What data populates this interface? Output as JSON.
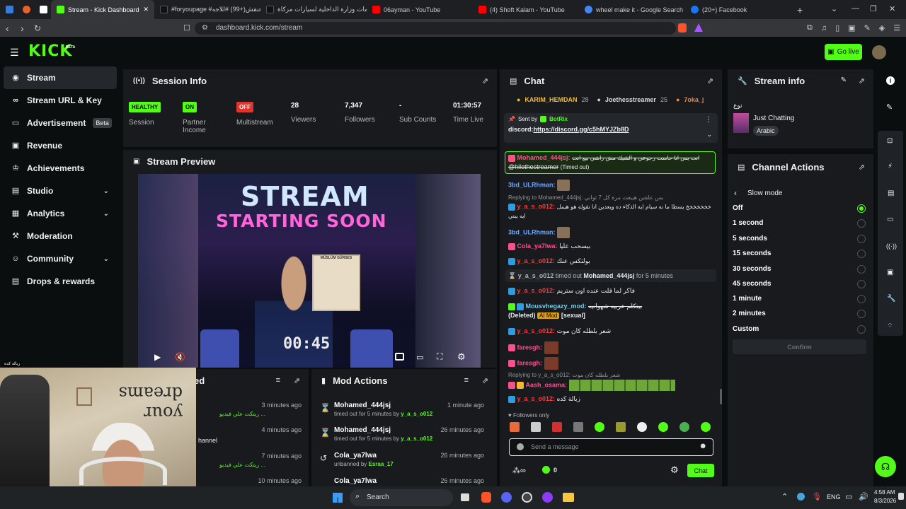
{
  "browser": {
    "tabs": [
      {
        "label": "",
        "color": "#3a7bd5"
      },
      {
        "label": "",
        "color": "#e8612c"
      },
      {
        "label": "",
        "color": "#ffffff"
      },
      {
        "label": "Stream - Kick Dashboard",
        "color": "#53fc18"
      },
      {
        "label": "#foryoupage #عنقش(+99) #للاجه",
        "color": "#111111"
      },
      {
        "label": "استعلامات وزارة الداخلية لسيارات مزكاة",
        "color": "#111111"
      },
      {
        "label": "06ayman - YouTube",
        "color": "#ff0000"
      },
      {
        "label": "(4) Shoft Kalam - YouTube",
        "color": "#ff0000"
      },
      {
        "label": "wheel make it - Google Search",
        "color": "#4285f4"
      },
      {
        "label": "(20+) Facebook",
        "color": "#1877f2"
      }
    ],
    "url": "dashboard.kick.com/stream"
  },
  "header": {
    "logo": "KICK",
    "beta": "BETA",
    "go_live": "Go live"
  },
  "sidebar": [
    {
      "label": "Stream",
      "icon": "broadcast-icon"
    },
    {
      "label": "Stream URL & Key",
      "icon": "link-icon"
    },
    {
      "label": "Advertisement",
      "icon": "ad-icon",
      "badge": "Beta"
    },
    {
      "label": "Revenue",
      "icon": "dollar-icon"
    },
    {
      "label": "Achievements",
      "icon": "trophy-icon"
    },
    {
      "label": "Studio",
      "icon": "studio-icon",
      "chevron": true
    },
    {
      "label": "Analytics",
      "icon": "chart-icon",
      "chevron": true
    },
    {
      "label": "Moderation",
      "icon": "hammer-icon"
    },
    {
      "label": "Community",
      "icon": "people-icon",
      "chevron": true
    },
    {
      "label": "Drops & rewards",
      "icon": "gift-icon"
    }
  ],
  "session": {
    "title": "Session Info",
    "health_badge": "HEALTHY",
    "health_label": "Session",
    "partner_badge": "ON",
    "partner_label": "Partner Income",
    "multistream_badge": "OFF",
    "multistream_label": "Multistream",
    "viewers_value": "28",
    "viewers_label": "Viewers",
    "followers_value": "7,347",
    "followers_label": "Followers",
    "subs_value": "-",
    "subs_label": "Sub Counts",
    "time_value": "01:30:57",
    "time_label": "Time Live"
  },
  "preview": {
    "title": "Stream Preview",
    "overlay_line1": "STREAM",
    "overlay_line2": "STARTING SOON",
    "timer": "00:45",
    "poster": "MÜSLÜM GÜRSES"
  },
  "recent": {
    "title_suffix": "ed",
    "rows": [
      {
        "text": "ريتكت علي فيديو ...",
        "time": "3 minutes ago"
      },
      {
        "text": "hannel",
        "time": "4 minutes ago"
      },
      {
        "text": "ريتكت علي فيديو ...",
        "time": "7 minutes ago"
      },
      {
        "text": "",
        "time": "10 minutes ago"
      }
    ]
  },
  "mod_actions": {
    "title": "Mod Actions",
    "rows": [
      {
        "name": "Mohamed_444jsj",
        "sub": "timed out for 5 minutes by",
        "by": "y_a_s_o012",
        "time": "1 minute ago",
        "icon": "hourglass-icon"
      },
      {
        "name": "Mohamed_444jsj",
        "sub": "timed out for 5 minutes by",
        "by": "y_a_s_o012",
        "time": "26 minutes ago",
        "icon": "hourglass-icon"
      },
      {
        "name": "Cola_ya7lwa",
        "sub": "unbanned by",
        "by": "Esraa_17",
        "time": "26 minutes ago",
        "icon": "undo-icon"
      },
      {
        "name": "Cola_ya7lwa",
        "sub": "",
        "by": "",
        "time": "26 minutes ago",
        "icon": "hourglass-icon"
      }
    ]
  },
  "chat": {
    "title": "Chat",
    "top_users": [
      {
        "name": "KARIM_HEMDAN",
        "count": "28"
      },
      {
        "name": "Joethesstreamer",
        "count": "25"
      },
      {
        "name": "7oka_j",
        "count": ""
      }
    ],
    "pinned_by_label": "Sent by",
    "pinned_by": "BotRix",
    "pinned_text": "discord:",
    "pinned_link": "https://discord.gg/c5hMYJZb8D",
    "messages": [
      {
        "user": "Mohamed_444jsj:",
        "text": "انت يس انا حاست رجوعي و الشيك مش راشي بيع انت",
        "extra": "@hilothestreamer",
        "note": "(Timed out)",
        "style": "highlight"
      },
      {
        "user": "3bd_ULRhman:",
        "text": "",
        "style": "normal"
      },
      {
        "reply": "Replying to Mohamed_444jsj: بس علشن هيبعت مرة كل 7 ثواني",
        "user": "y_a_s_o012:",
        "text": "خخخخخخخ يسطا ما نه سيام ايه الذكاء ده ويعدين انا نقوله هو هيمل ايه يبني",
        "style": "normal"
      },
      {
        "user": "3bd_ULRhman:",
        "text": "",
        "style": "normal"
      },
      {
        "user": "Cola_ya7lwa:",
        "text": "بيسحب عليا",
        "style": "normal"
      },
      {
        "user": "y_a_s_o012:",
        "text": "بولتكس عنك",
        "style": "normal"
      },
      {
        "system_user": "y_a_s_o012",
        "system_action": "timed out",
        "system_target": "Mohamed_444jsj",
        "system_suffix": "for 5 minutes",
        "style": "system"
      },
      {
        "user": "y_a_s_o012:",
        "text": "فاكر لما قلت عنده اون ستريم",
        "style": "normal"
      },
      {
        "user": "Mousvhegazy_mod:",
        "text": "بيتكلم عربيه شهوانيه",
        "extra": "(Deleted)",
        "tag": "AI Mod",
        "note": "[sexual]",
        "style": "normal"
      },
      {
        "user": "y_a_s_o012:",
        "text": "شعر بلطله كان موت",
        "style": "normal"
      },
      {
        "user": "faresgh:",
        "text": "",
        "style": "normal"
      },
      {
        "user": "faresgh:",
        "text": "",
        "style": "normal"
      },
      {
        "reply": "Replying to y_a_s_o012: شعر بلطله كان موت",
        "user": "Aash_osama:",
        "text": "",
        "style": "normal"
      },
      {
        "user": "y_a_s_o012:",
        "text": "زبالة كده",
        "style": "normal"
      }
    ],
    "followers_only": "Followers only",
    "input_placeholder": "Send a message",
    "counter": "0",
    "send_label": "Chat"
  },
  "stream_info": {
    "title": "Stream info",
    "category": "Just Chatting",
    "language": "Arabic",
    "label_top": "نوع"
  },
  "channel_actions": {
    "title": "Channel Actions",
    "back_label": "Slow mode",
    "options": [
      "Off",
      "1 second",
      "5 seconds",
      "15 seconds",
      "30 seconds",
      "45 seconds",
      "1 minute",
      "2 minutes",
      "Custom"
    ],
    "selected_index": 0,
    "confirm_label": "Confirm"
  },
  "taskbar": {
    "search": "Search",
    "lang": "ENG",
    "time": "4:58 AM",
    "date": "8/3/2026"
  },
  "colors": {
    "accent": "#53fc18",
    "panel": "#181a1d",
    "bg": "#0b0e0f",
    "off": "#e0342c"
  }
}
